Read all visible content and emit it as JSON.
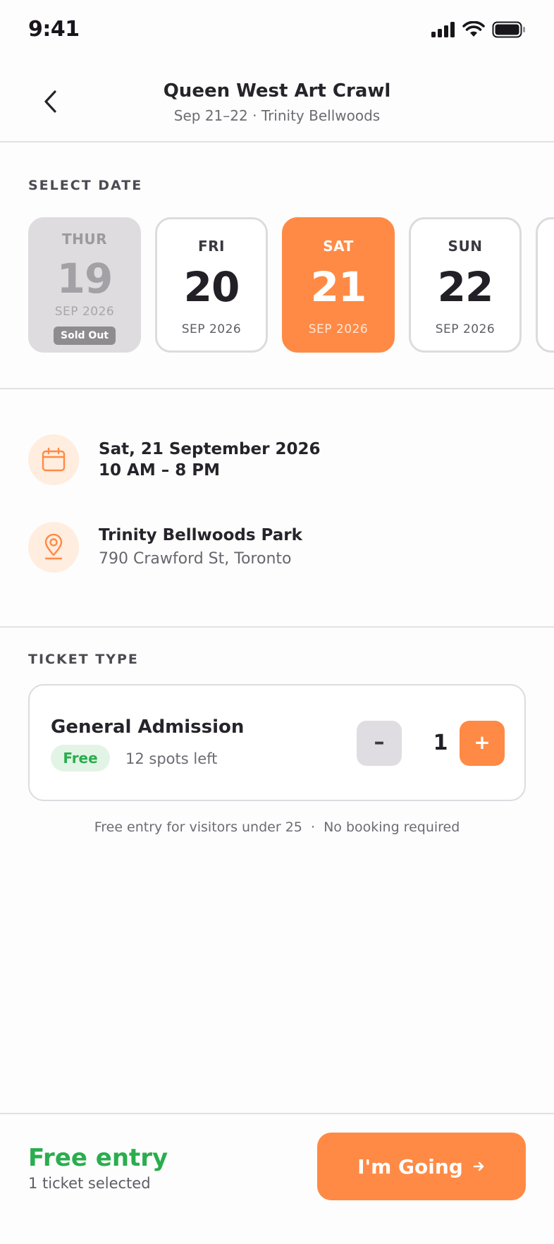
{
  "status_bar": {
    "time": "9:41"
  },
  "header": {
    "title": "Queen West Art Crawl",
    "subtitle": "Sep 21–22 · Trinity Bellwoods"
  },
  "date_section": {
    "label": "SELECT DATE",
    "dates": [
      {
        "dow": "THUR",
        "day": "19",
        "month": "SEP 2026",
        "badge": "Sold Out",
        "state": "sold_out"
      },
      {
        "dow": "FRI",
        "day": "20",
        "month": "SEP 2026",
        "state": "available"
      },
      {
        "dow": "SAT",
        "day": "21",
        "month": "SEP 2026",
        "state": "selected"
      },
      {
        "dow": "SUN",
        "day": "22",
        "month": "SEP 2026",
        "state": "available"
      }
    ]
  },
  "details": {
    "date_line": "Sat, 21 September 2026",
    "time_line": "10 AM – 8 PM",
    "venue": "Trinity Bellwoods Park",
    "address": "790 Crawford St, Toronto"
  },
  "ticket_section": {
    "label": "TICKET TYPE",
    "ticket": {
      "name": "General Admission",
      "price_badge": "Free",
      "availability": "12 spots left",
      "minus_label": "–",
      "quantity": "1",
      "plus_label": "+"
    },
    "note": "Free entry for visitors under 25  ·  No booking required"
  },
  "footer": {
    "price": "Free entry",
    "selection": "1 ticket selected",
    "cta_label": "I'm Going"
  },
  "colors": {
    "accent": "#ff8a45",
    "success": "#2aad4e",
    "sold_out": "#dedcdf"
  },
  "icons": {
    "back": "chevron-left-icon",
    "calendar": "calendar-icon",
    "location": "map-pin-icon",
    "cta": "arrow-right-icon"
  }
}
